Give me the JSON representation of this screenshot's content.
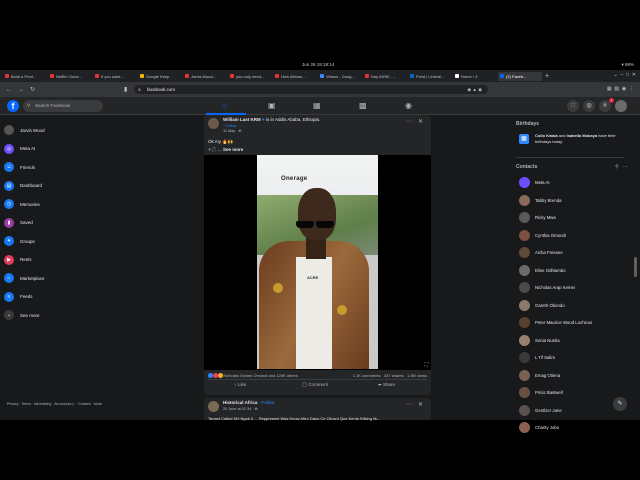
{
  "os": {
    "clock": "Jun 26  19:18:14",
    "status": "▾ 88%"
  },
  "browser": {
    "tabs": [
      {
        "label": "Build a Prod...",
        "color": "#e43535"
      },
      {
        "label": "Netflix Clone...",
        "color": "#e43535"
      },
      {
        "label": "If you want...",
        "color": "#e43535"
      },
      {
        "label": "Google Keep",
        "color": "#f5b400"
      },
      {
        "label": "Jamis Mucci...",
        "color": "#e43535"
      },
      {
        "label": "you only need...",
        "color": "#e43535"
      },
      {
        "label": "How African...",
        "color": "#e43535"
      },
      {
        "label": "Videos - Goog...",
        "color": "#4285f4"
      },
      {
        "label": "Day 69/90 - ...",
        "color": "#e43535"
      },
      {
        "label": "Feed | LinkedI...",
        "color": "#0a66c2"
      },
      {
        "label": "Home / X",
        "color": "#ffffff"
      },
      {
        "label": "(2) Faceb...",
        "color": "#0866ff"
      }
    ],
    "url": "facebook.com"
  },
  "fb": {
    "search_placeholder": "Search Facebook",
    "logo": "f",
    "notif_count": "2",
    "left_nav": [
      {
        "label": "Jarvis Wood",
        "icon": "avatar-icon",
        "color": "#555555",
        "glyph": ""
      },
      {
        "label": "Meta AI",
        "icon": "meta-ai-icon",
        "color": "#6b4eff",
        "glyph": "◎"
      },
      {
        "label": "Friends",
        "icon": "friends-icon",
        "color": "#1877f2",
        "glyph": "☺"
      },
      {
        "label": "Dashboard",
        "icon": "dashboard-icon",
        "color": "#1877f2",
        "glyph": "▤"
      },
      {
        "label": "Memories",
        "icon": "memories-icon",
        "color": "#1877f2",
        "glyph": "◷"
      },
      {
        "label": "Saved",
        "icon": "saved-icon",
        "color": "#9c3aa6",
        "glyph": "▮"
      },
      {
        "label": "Groups",
        "icon": "groups-icon",
        "color": "#1877f2",
        "glyph": "✦"
      },
      {
        "label": "Reels",
        "icon": "reels-icon",
        "color": "#e03d5c",
        "glyph": "▶"
      },
      {
        "label": "Marketplace",
        "icon": "marketplace-icon",
        "color": "#1877f2",
        "glyph": "⌂"
      },
      {
        "label": "Feeds",
        "icon": "feeds-icon",
        "color": "#1877f2",
        "glyph": "≡"
      },
      {
        "label": "See more",
        "icon": "chevron-down-icon",
        "color": "#3a3b3c",
        "glyph": "⌄"
      }
    ],
    "footer_text": "Privacy · Terms · Advertising · Ad choices ▷ · Cookies · More",
    "post1": {
      "author": "William Last KRM",
      "location_text": "is in Addis Ababa, Ethiopia.",
      "follow": "Follow",
      "date": "11 May · ⊕",
      "text": "Ok my 🔥🙌",
      "text2": "⚡🎵 ...",
      "see_more": "See more",
      "video_caption": "Onerage",
      "shirt_text": "ACRE",
      "reactions_text": "Nicholas Orcilek Omondi and 125K others",
      "comments": "1.1K comments",
      "shares": "437 shares",
      "views": "1.9M views",
      "like_label": "Like",
      "comment_label": "Comment",
      "share_label": "Share"
    },
    "post2": {
      "author": "Historical Africa",
      "follow": "Follow",
      "date": "20 June at 02:34 · ⊕",
      "text": "Tenant Called NH Ngok II ... Reppresent Was Know Attro Dans Ce Clivant Que Kenia Stiking lik..."
    },
    "birthdays": {
      "header": "Birthdays",
      "name1": "Collo Kwala",
      "and": " and ",
      "name2": "Isabella Mokaya",
      "rest": " have their birthdays today."
    },
    "contacts_header": "Contacts",
    "contacts": [
      {
        "name": "Meta AI",
        "color": "#6b4eff"
      },
      {
        "name": "Tabby Brenda",
        "color": "#8a6a5a"
      },
      {
        "name": "Ricky Mwa",
        "color": "#5a5a5a"
      },
      {
        "name": "Cynthia Omondi",
        "color": "#7a5040"
      },
      {
        "name": "Aicha Freesee",
        "color": "#5e4a3a"
      },
      {
        "name": "Eline Odhiambo",
        "color": "#6a6a6a"
      },
      {
        "name": "Nicholas Arap Kemei",
        "color": "#4a4a4a"
      },
      {
        "name": "Gareth Obondo",
        "color": "#8a7a6a"
      },
      {
        "name": "Peter Maurice Wood Lochicus",
        "color": "#5a4030"
      },
      {
        "name": "Sonia Nusha",
        "color": "#9a8070"
      },
      {
        "name": "L Tif Salim",
        "color": "#3a3a3a"
      },
      {
        "name": "Emag Otiena",
        "color": "#7a6050"
      },
      {
        "name": "Pricis Bastwell",
        "color": "#6a5040"
      },
      {
        "name": "Gentlzer Jane",
        "color": "#5a5050"
      },
      {
        "name": "Charity Jobo",
        "color": "#8a6050"
      }
    ]
  }
}
